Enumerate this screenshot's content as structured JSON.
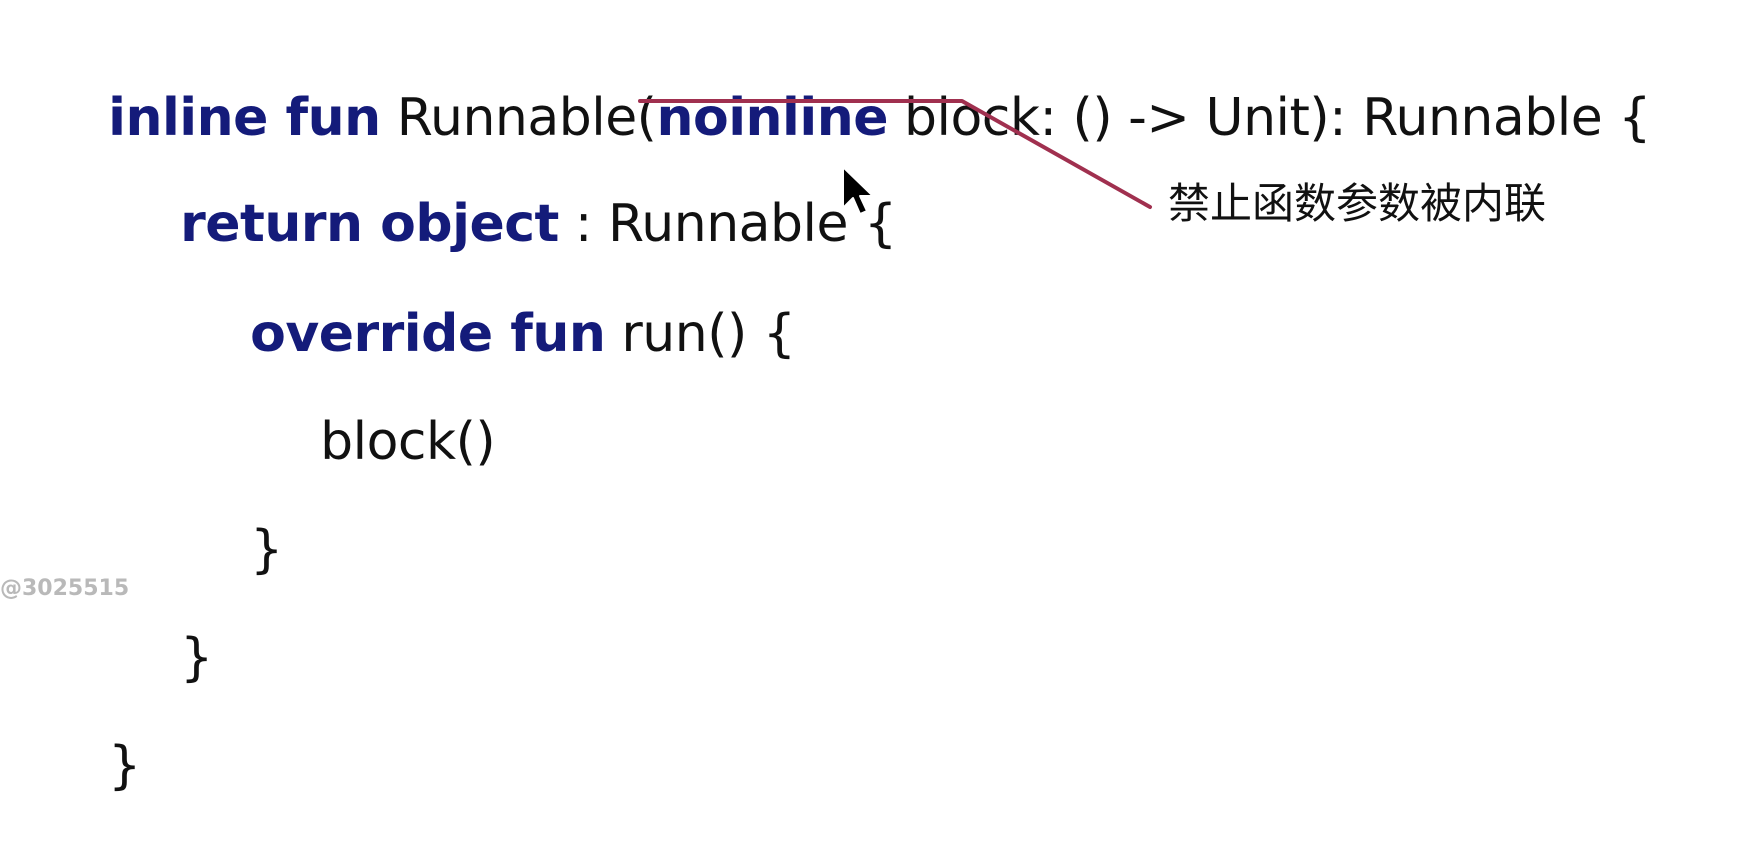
{
  "code": {
    "line1": {
      "kw1": "inline fun",
      "t1": " Runnable(",
      "kw2": "noinline",
      "t2": " block: () -> Unit): Runnable {"
    },
    "line2": {
      "kw1": "return object",
      "t1": " : Runnable {"
    },
    "line3": {
      "kw1": "override fun",
      "t1": " run() {"
    },
    "line4": {
      "t1": "block()"
    },
    "line5": {
      "t1": "}"
    },
    "line6": {
      "t1": "}"
    },
    "line7": {
      "t1": "}"
    }
  },
  "annotation": {
    "text": "禁止函数参数被内联"
  },
  "watermark": {
    "text": "@3025515"
  },
  "colors": {
    "keyword": "#141b7a",
    "text": "#111111",
    "callout_line": "#a0304f",
    "watermark": "#b9b9b9"
  },
  "icons": {
    "cursor": "mouse-cursor-icon"
  }
}
